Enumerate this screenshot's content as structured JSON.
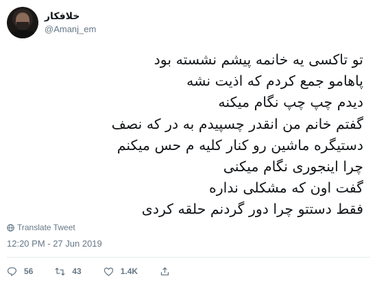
{
  "user": {
    "display_name": "خلافکار",
    "handle": "@Amanj_em"
  },
  "tweet": {
    "lines": [
      "تو تاکسی یه خانمه پیشم نشسته بود",
      "پاهامو جمع کردم که اذیت نشه",
      "دیدم چپ چپ نگام میکنه",
      "گفتم خانم من انقدر چسپیدم به در که نصف",
      "دستیگره ماشین رو کنار کلیه م حس میکنم",
      "چرا اینجوری نگام میکنی",
      "گفت اون که مشکلی نداره",
      "فقط دستتو چرا دور گردنم حلقه کردی"
    ],
    "translate_label": "Translate Tweet",
    "timestamp": "12:20 PM - 27 Jun 2019"
  },
  "actions": {
    "reply_count": "56",
    "retweet_count": "43",
    "like_count": "1.4K",
    "icons": [
      "reply-icon",
      "retweet-icon",
      "like-icon",
      "share-icon"
    ]
  },
  "colors": {
    "text": "#14171a",
    "secondary": "#657786",
    "divider": "#e6ecf0"
  }
}
